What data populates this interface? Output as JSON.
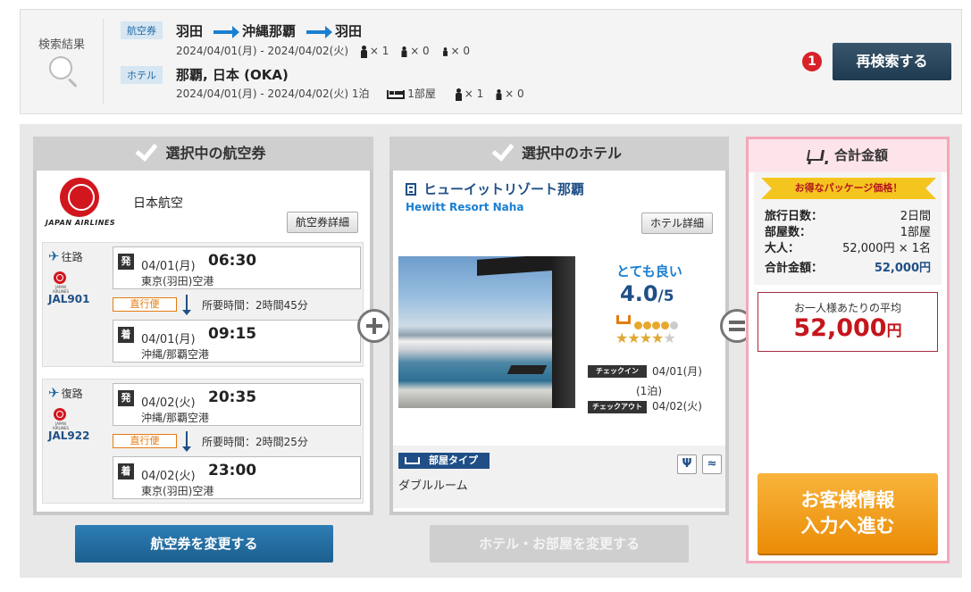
{
  "summary": {
    "label": "検索結果",
    "flight": {
      "tag": "航空券",
      "origin": "羽田",
      "destination": "沖縄那覇",
      "return": "羽田",
      "dates": "2024/04/01(月) - 2024/04/02(火)",
      "adults": "× 1",
      "children": "× 0",
      "infants": "× 0"
    },
    "hotel": {
      "tag": "ホテル",
      "location": "那覇, 日本 (OKA)",
      "dates": "2024/04/01(月) - 2024/04/02(火) 1泊",
      "rooms": "1部屋",
      "adults": "× 1",
      "children": "× 0"
    },
    "step_badge": "1",
    "research_button": "再検索する"
  },
  "flight_card": {
    "title": "選択中の航空券",
    "airline_logo_text": "JAPAN AIRLINES",
    "airline_name": "日本航空",
    "detail_button": "航空券詳細",
    "mini_logo_caption": "JAPAN AIRLINES",
    "outbound": {
      "direction": "往路",
      "flight_no": "JAL901",
      "depart_label": "発",
      "depart_date": "04/01(月)",
      "depart_time": "06:30",
      "depart_airport": "東京(羽田)空港",
      "direct_label": "直行便",
      "duration": "所要時間：2時間45分",
      "arrive_label": "着",
      "arrive_date": "04/01(月)",
      "arrive_time": "09:15",
      "arrive_airport": "沖縄/那覇空港"
    },
    "return": {
      "direction": "復路",
      "flight_no": "JAL922",
      "depart_label": "発",
      "depart_date": "04/02(火)",
      "depart_time": "20:35",
      "depart_airport": "沖縄/那覇空港",
      "direct_label": "直行便",
      "duration": "所要時間：2時間25分",
      "arrive_label": "着",
      "arrive_date": "04/02(火)",
      "arrive_time": "23:00",
      "arrive_airport": "東京(羽田)空港"
    },
    "change_button": "航空券を変更する"
  },
  "hotel_card": {
    "title": "選択中のホテル",
    "name": "ヒューイットリゾート那覇",
    "name_en": "Hewitt Resort Naha",
    "detail_button": "ホテル詳細",
    "rating_text": "とても良い",
    "rating_score": "4.0",
    "rating_max": "/5",
    "rating_dots": 4,
    "star_rating": 3.5,
    "checkin_label": "チェックイン",
    "checkin_date": "04/01(月)",
    "nights": "(1泊)",
    "checkout_label": "チェックアウト",
    "checkout_date": "04/02(火)",
    "room_type_label": "部屋タイプ",
    "room_name": "ダブルルーム",
    "amenity_icons": [
      "restaurant-icon",
      "wifi-icon"
    ],
    "change_button": "ホテル・お部屋を変更する"
  },
  "total_card": {
    "title": "合計金額",
    "ribbon": "お得なパッケージ価格！",
    "rows": [
      {
        "label": "旅行日数：",
        "value": "2日間"
      },
      {
        "label": "部屋数：",
        "value": "1部屋"
      },
      {
        "label": "大人：",
        "value": "52,000円 × 1名"
      },
      {
        "label": "合計金額：",
        "value": "52,000円"
      }
    ],
    "avg_label": "お一人様あたりの平均",
    "avg_value": "52,000",
    "avg_unit": "円",
    "proceed_line1": "お客様情報",
    "proceed_line2": "入力へ進む"
  },
  "colors": {
    "primary_blue": "#1f4f86",
    "link_blue": "#1a7fd1",
    "accent_orange": "#ea8c06",
    "price_red": "#c5161d",
    "total_border_pink": "#f3a7ba"
  }
}
